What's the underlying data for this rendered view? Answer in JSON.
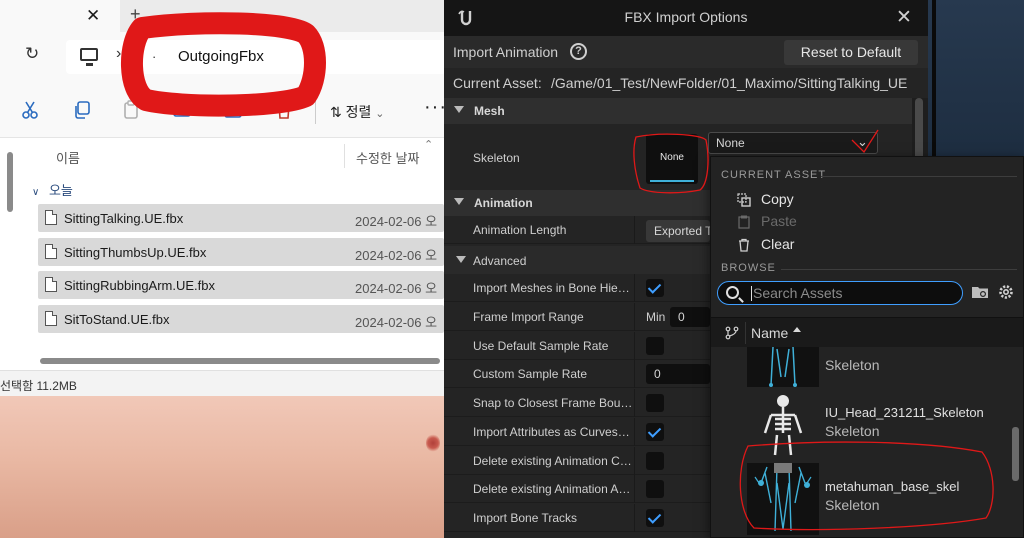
{
  "explorer": {
    "tab_close": "✕",
    "tab_plus": "+",
    "breadcrumb_sep": "›",
    "breadcrumb_dot": "·",
    "folder": "OutgoingFbx",
    "sort_label": "정렬",
    "more": "···",
    "col_name": "이름",
    "col_date": "수정한 날짜",
    "group": "오늘",
    "files": [
      {
        "name": "SittingTalking.UE.fbx",
        "date": "2024-02-06 오"
      },
      {
        "name": "SittingThumbsUp.UE.fbx",
        "date": "2024-02-06 오"
      },
      {
        "name": "SittingRubbingArm.UE.fbx",
        "date": "2024-02-06 오"
      },
      {
        "name": "SitToStand.UE.fbx",
        "date": "2024-02-06 오"
      }
    ],
    "status": "선택함 11.2MB"
  },
  "dialog": {
    "title": "FBX Import Options",
    "close": "✕",
    "import_animation": "Import Animation",
    "help": "?",
    "reset": "Reset to Default",
    "current_asset_label": "Current Asset:",
    "current_asset_value": "/Game/01_Test/NewFolder/01_Maximo/SittingTalking_UE",
    "sections": {
      "mesh": "Mesh",
      "animation": "Animation",
      "advanced": "Advanced"
    },
    "skeleton": {
      "label": "Skeleton",
      "thumb": "None",
      "value": "None",
      "chevron": "⌄"
    },
    "anim_length": {
      "label": "Animation Length",
      "value": "Exported T"
    },
    "props": [
      {
        "label": "Import Meshes in Bone Hierar...",
        "checked": true
      },
      {
        "label": "Frame Import Range",
        "min_label": "Min",
        "min_value": "0"
      },
      {
        "label": "Use Default Sample Rate",
        "checked": false
      },
      {
        "label": "Custom Sample Rate",
        "value": "0"
      },
      {
        "label": "Snap to Closest Frame Bound...",
        "checked": false
      },
      {
        "label": "Import Attributes as Curves o...",
        "checked": true
      },
      {
        "label": "Delete existing Animation Cur...",
        "checked": false
      },
      {
        "label": "Delete existing Animation Attri...",
        "checked": false
      },
      {
        "label": "Import Bone Tracks",
        "checked": true
      }
    ]
  },
  "menu": {
    "current_asset_header": "CURRENT ASSET",
    "copy": "Copy",
    "paste": "Paste",
    "clear": "Clear",
    "browse_header": "BROWSE",
    "search_placeholder": "Search Assets",
    "name_col": "Name",
    "assets": [
      {
        "name": "",
        "type": "Skeleton"
      },
      {
        "name": "IU_Head_231211_Skeleton",
        "type": "Skeleton"
      },
      {
        "name": "metahuman_base_skel",
        "type": "Skeleton"
      }
    ]
  },
  "colors": {
    "accent": "#3f9eff",
    "annotation": "#e01818",
    "skeleton_bone": "#3fb0d8"
  }
}
